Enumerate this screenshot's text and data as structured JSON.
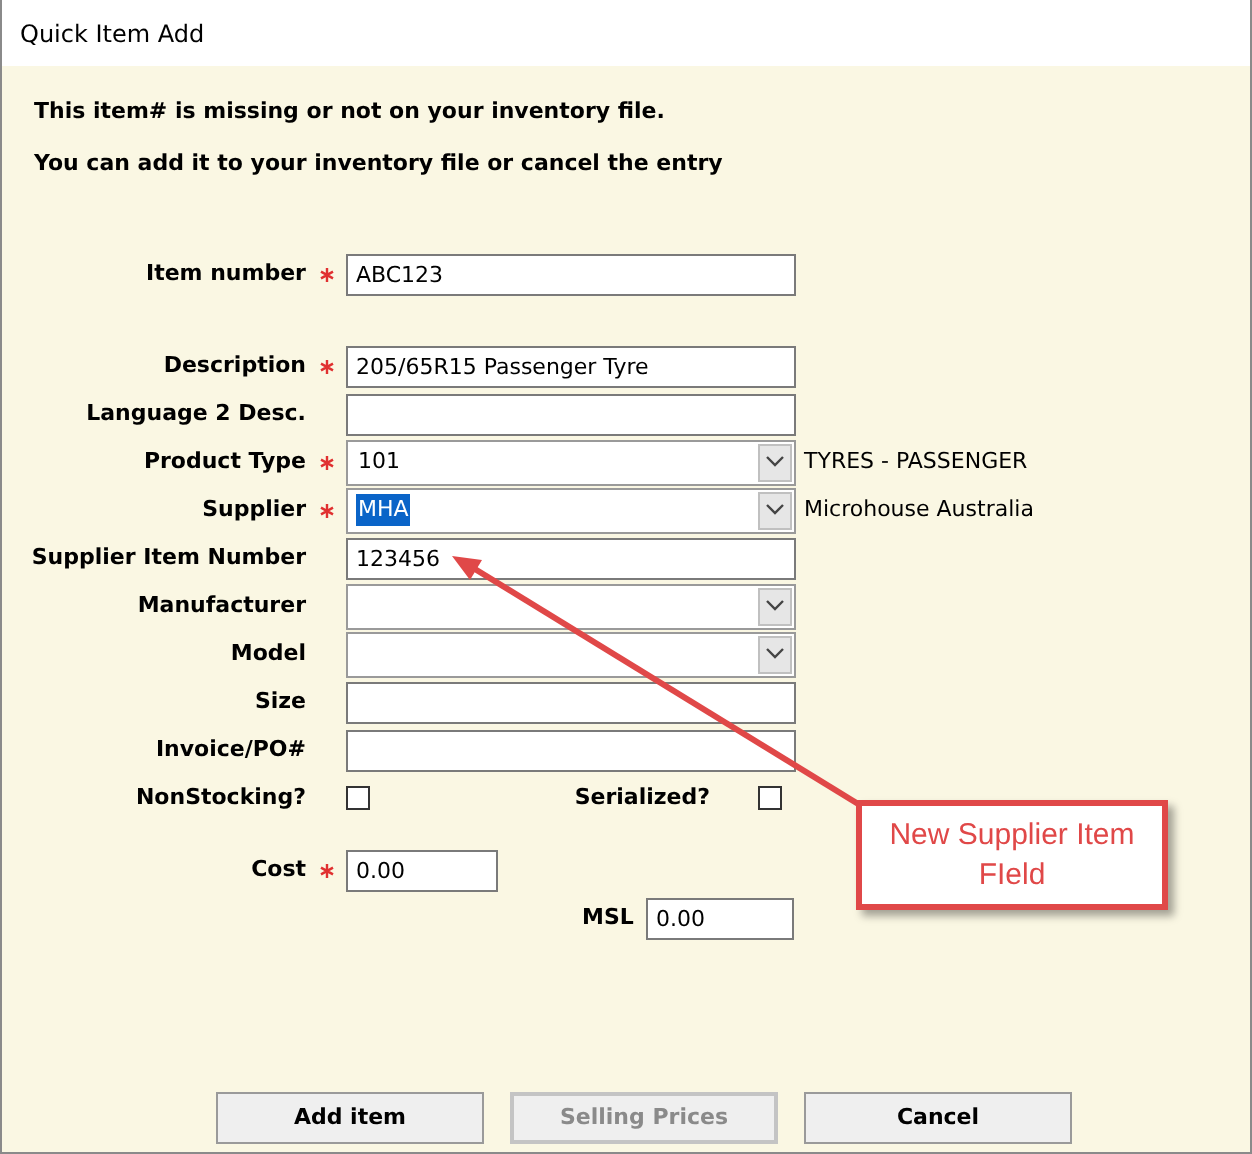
{
  "window": {
    "title": "Quick Item Add"
  },
  "messages": [
    "This item# is missing or not on your inventory file.",
    "You can add it to your inventory file or cancel the entry"
  ],
  "sections": [
    {
      "rows": [
        {
          "kind": "text",
          "label": "Item number",
          "required": true,
          "value": "ABC123"
        }
      ]
    },
    {
      "rows": [
        {
          "kind": "text",
          "label": "Description",
          "required": true,
          "value": "205/65R15 Passenger Tyre"
        },
        {
          "kind": "text",
          "label": "Language 2 Desc.",
          "required": false
        },
        {
          "kind": "select",
          "label": "Product Type",
          "required": true,
          "value": "101",
          "note": "TYRES - PASSENGER"
        },
        {
          "kind": "select",
          "label": "Supplier",
          "required": true,
          "value": "MHA",
          "value_highlighted": true,
          "note": "Microhouse Australia"
        },
        {
          "kind": "text",
          "label": "Supplier Item Number",
          "required": false,
          "value": "123456"
        },
        {
          "kind": "select",
          "label": "Manufacturer",
          "required": false
        },
        {
          "kind": "select",
          "label": "Model",
          "required": false
        },
        {
          "kind": "text",
          "label": "Size",
          "required": false
        },
        {
          "kind": "text",
          "label": "Invoice/PO#",
          "required": false
        }
      ]
    },
    {
      "rows": [
        {
          "kind": "checkboxes",
          "items": [
            {
              "label": "NonStocking?",
              "checked": false
            },
            {
              "label": "Serialized?",
              "checked": false
            }
          ]
        }
      ]
    },
    {
      "rows": [
        {
          "kind": "short",
          "label": "Cost",
          "required": true,
          "value": "0.00"
        },
        {
          "kind": "short_right",
          "label": "MSL",
          "required": false,
          "value": "0.00"
        }
      ]
    }
  ],
  "buttons": [
    {
      "label": "Add item",
      "disabled": false
    },
    {
      "label": "Selling Prices",
      "disabled": true
    },
    {
      "label": "Cancel",
      "disabled": false
    }
  ],
  "callout": {
    "text": "New Supplier Item FIeld"
  }
}
